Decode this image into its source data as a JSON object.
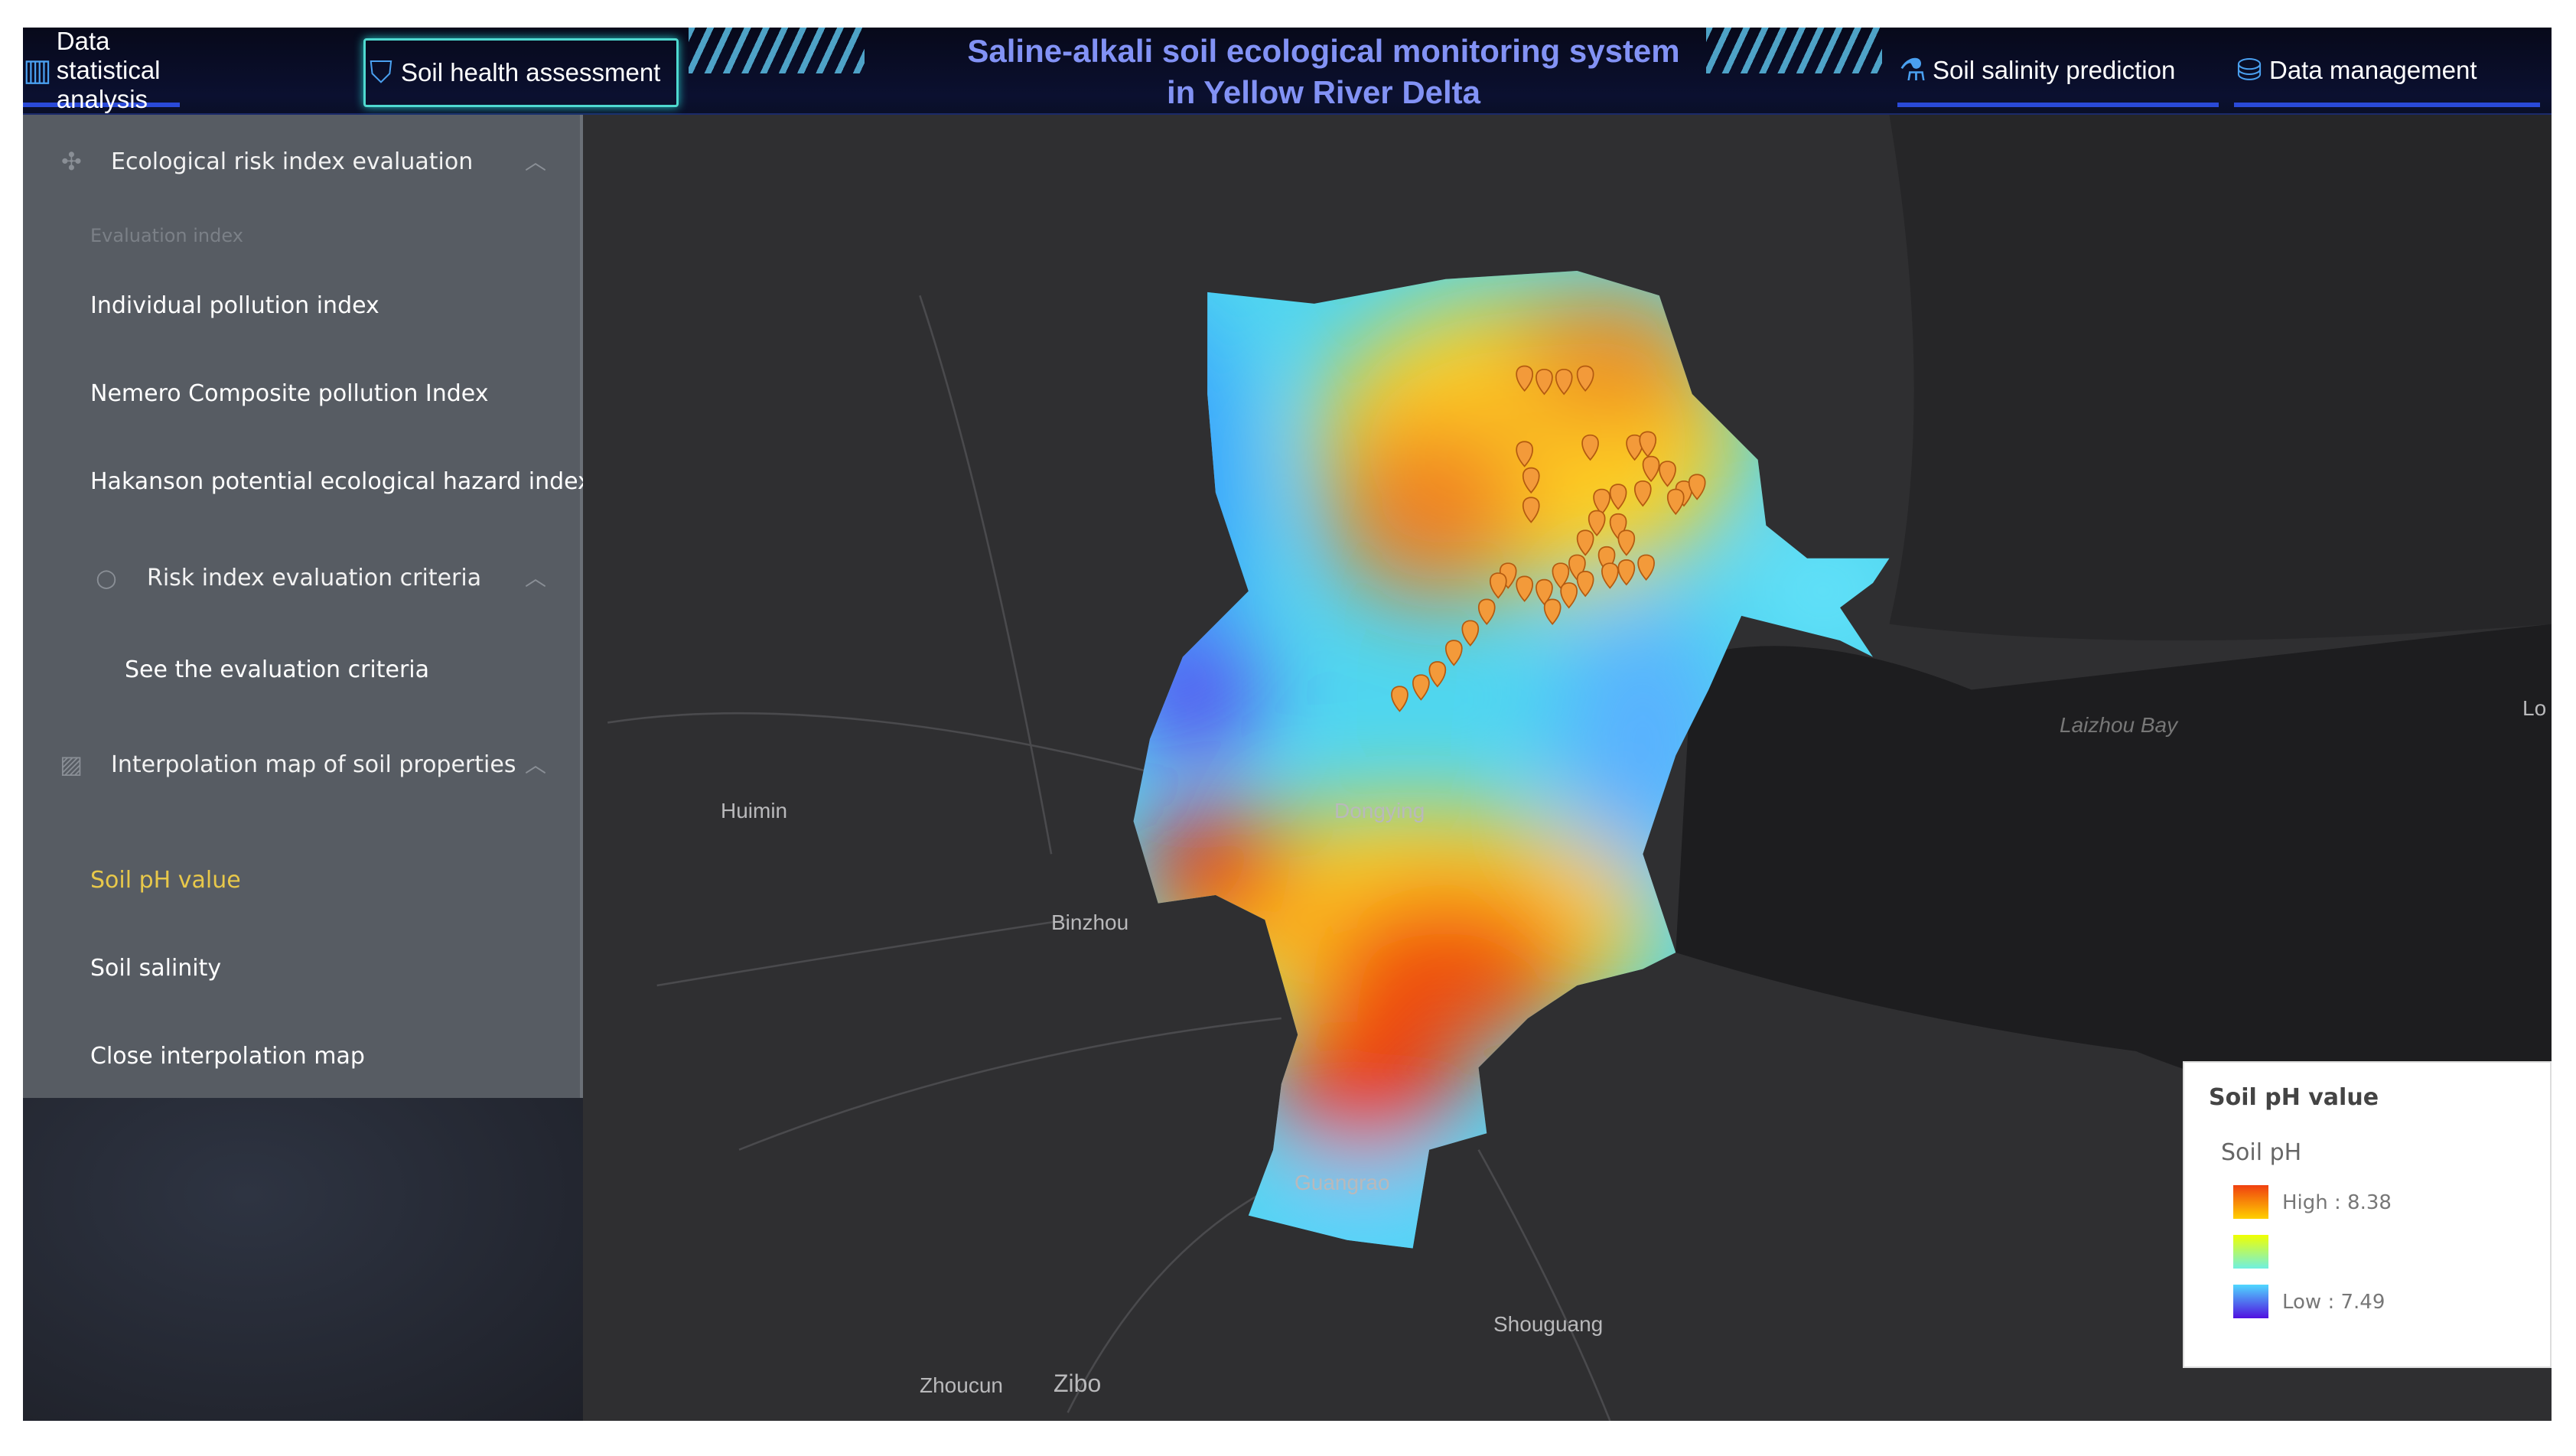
{
  "header": {
    "title_line1": "Saline-alkali soil ecological monitoring system",
    "title_line2": "in Yellow River Delta",
    "nav": [
      {
        "label": "Data statistical analysis",
        "icon": "bar-chart-icon"
      },
      {
        "label": "Soil health assessment",
        "icon": "shield-pulse-icon",
        "active": true
      },
      {
        "label": "Soil salinity prediction",
        "icon": "prediction-icon"
      },
      {
        "label": "Data management",
        "icon": "database-icon"
      }
    ]
  },
  "sidebar": {
    "section1": {
      "label": "Ecological risk index evaluation",
      "icon": "move-icon"
    },
    "evaluation_index_label": "Evaluation index",
    "items1": [
      "Individual pollution index",
      "Nemero Composite pollution Index",
      "Hakanson potential ecological hazard index"
    ],
    "section2": {
      "label": "Risk index evaluation criteria",
      "icon": "search-icon"
    },
    "criteria_link": "See the evaluation criteria",
    "section3": {
      "label": "Interpolation map of soil properties",
      "icon": "image-icon"
    },
    "items3": [
      "Soil pH value",
      "Soil salinity",
      "Close interpolation map"
    ],
    "selected": "Soil pH value",
    "selected_color": "#e8c84a"
  },
  "map": {
    "places": [
      "Huimin",
      "Binzhou",
      "Dongying",
      "Guangrao",
      "Shouguang",
      "Zhoucun",
      "Zibo",
      "Laizhou Bay",
      "Lo"
    ]
  },
  "legend": {
    "title": "Soil pH value",
    "subtitle": "Soil pH",
    "high_label": "High : 8.38",
    "low_label": "Low : 7.49",
    "high": 8.38,
    "low": 7.49
  }
}
